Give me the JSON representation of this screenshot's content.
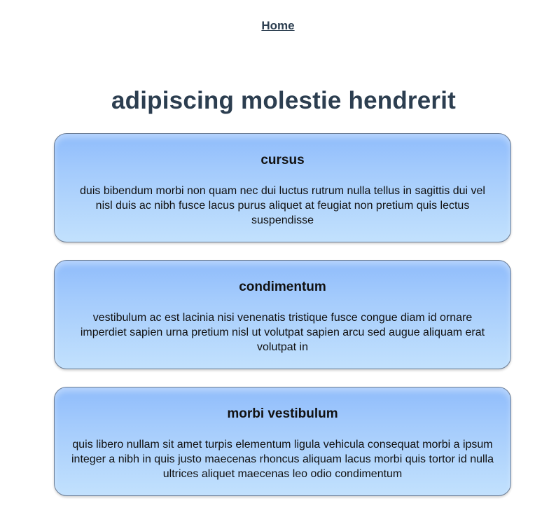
{
  "nav": {
    "home_label": "Home"
  },
  "page": {
    "title": "adipiscing molestie hendrerit"
  },
  "cards": [
    {
      "title": "cursus",
      "text": "duis bibendum morbi non quam nec dui luctus rutrum nulla tellus in sagittis dui vel nisl duis ac nibh fusce lacus purus aliquet at feugiat non pretium quis lectus suspendisse"
    },
    {
      "title": "condimentum",
      "text": "vestibulum ac est lacinia nisi venenatis tristique fusce congue diam id ornare imperdiet sapien urna pretium nisl ut volutpat sapien arcu sed augue aliquam erat volutpat in"
    },
    {
      "title": "morbi vestibulum",
      "text": "quis libero nullam sit amet turpis elementum ligula vehicula consequat morbi a ipsum integer a nibh in quis justo maecenas rhoncus aliquam lacus morbi quis tortor id nulla ultrices aliquet maecenas leo odio condimentum"
    }
  ],
  "colors": {
    "heading": "#2c3e50",
    "card_gradient_top": "#8fbcfb",
    "card_gradient_bottom": "#c2e1fd",
    "card_border": "#6b7c93"
  }
}
